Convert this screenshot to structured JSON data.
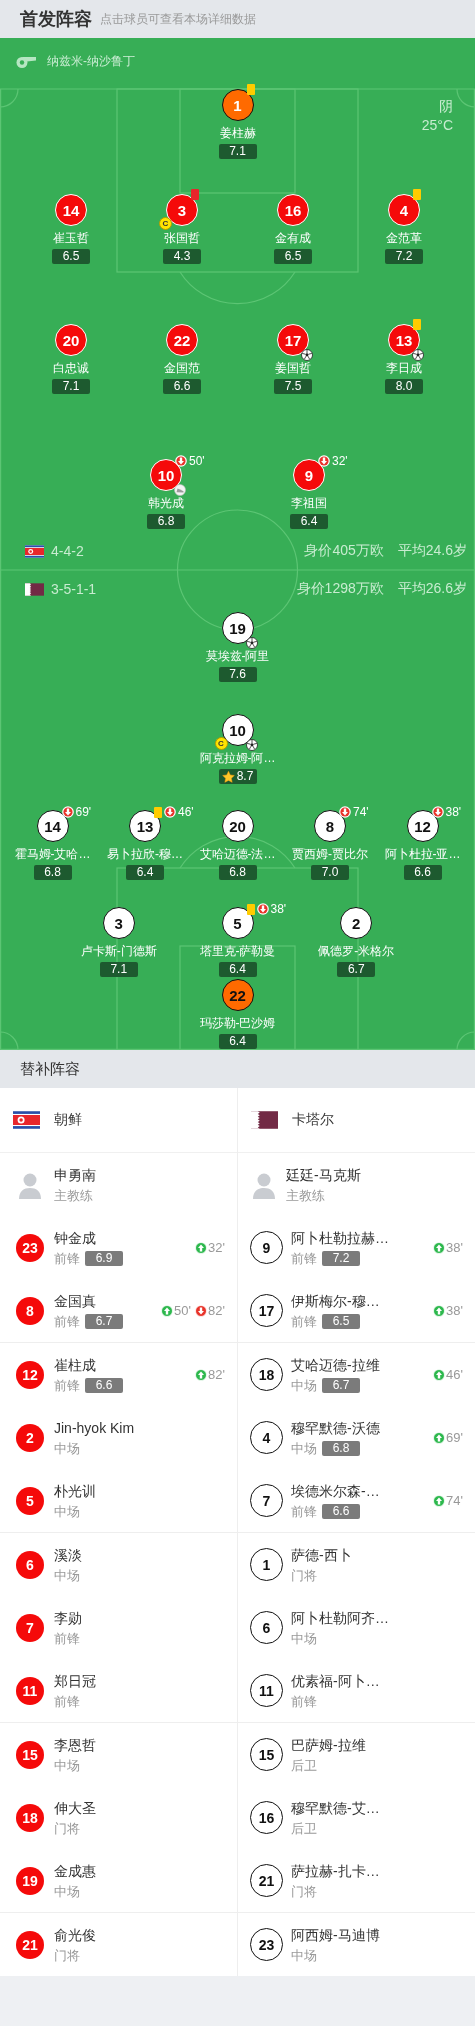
{
  "header": {
    "title": "首发阵容",
    "hint": "点击球员可查看本场详细数据"
  },
  "pitch": {
    "referee": "纳兹米-纳沙鲁丁",
    "weather": "阴",
    "temperature": "25°C",
    "teams": [
      {
        "kind": "home",
        "formation": "4-4-2",
        "value": "身价405万欧",
        "average_age": "平均24.6岁",
        "rows": [
          {
            "players": [
              {
                "number": "1",
                "name": "姜柱赫",
                "rating": "7.1",
                "keeper": true,
                "best": false,
                "yellow_card": true,
                "red_card": false,
                "goal": false,
                "assist": false
              }
            ]
          },
          {
            "players": [
              {
                "number": "14",
                "name": "崔玉哲",
                "rating": "6.5",
                "keeper": false,
                "best": false,
                "yellow_card": false,
                "red_card": false,
                "goal": false,
                "assist": false
              },
              {
                "number": "3",
                "name": "张国哲",
                "rating": "4.3",
                "keeper": false,
                "best": false,
                "yellow_card": false,
                "red_card": true,
                "goal": false,
                "assist": false,
                "captain_badge": "C"
              },
              {
                "number": "16",
                "name": "金有成",
                "rating": "6.5",
                "keeper": false,
                "best": false,
                "yellow_card": false,
                "red_card": false,
                "goal": false,
                "assist": false
              },
              {
                "number": "4",
                "name": "金范革",
                "rating": "7.2",
                "keeper": false,
                "best": false,
                "yellow_card": true,
                "red_card": false,
                "goal": false,
                "assist": false
              }
            ]
          },
          {
            "players": [
              {
                "number": "20",
                "name": "白忠诚",
                "rating": "7.1",
                "keeper": false,
                "best": false,
                "yellow_card": false,
                "red_card": false,
                "goal": false,
                "assist": false
              },
              {
                "number": "22",
                "name": "金国范",
                "rating": "6.6",
                "keeper": false,
                "best": false,
                "yellow_card": false,
                "red_card": false,
                "goal": false,
                "assist": false
              },
              {
                "number": "17",
                "name": "姜国哲",
                "rating": "7.5",
                "keeper": false,
                "best": false,
                "yellow_card": false,
                "red_card": false,
                "goal": true,
                "assist": false
              },
              {
                "number": "13",
                "name": "李日成",
                "rating": "8.0",
                "keeper": false,
                "best": false,
                "yellow_card": true,
                "red_card": false,
                "goal": true,
                "assist": false
              }
            ]
          },
          {
            "players": [
              {
                "number": "10",
                "name": "韩光成",
                "rating": "6.8",
                "keeper": false,
                "best": false,
                "yellow_card": false,
                "red_card": false,
                "goal": false,
                "assist": true,
                "sub_out": "50'"
              },
              {
                "number": "9",
                "name": "李祖国",
                "rating": "6.4",
                "keeper": false,
                "best": false,
                "yellow_card": false,
                "red_card": false,
                "goal": false,
                "assist": false,
                "sub_out": "32'"
              }
            ]
          }
        ]
      },
      {
        "kind": "away",
        "formation": "3-5-1-1",
        "value": "身价1298万欧",
        "average_age": "平均26.6岁",
        "rows": [
          {
            "players": [
              {
                "number": "19",
                "name": "莫埃兹-阿里",
                "rating": "7.6",
                "keeper": false,
                "best": false,
                "yellow_card": false,
                "red_card": false,
                "goal": true,
                "assist": false
              }
            ]
          },
          {
            "players": [
              {
                "number": "10",
                "name": "阿克拉姆-阿…",
                "rating": "8.7",
                "keeper": false,
                "best": true,
                "yellow_card": false,
                "red_card": false,
                "goal": true,
                "assist": false,
                "captain_badge": "C"
              }
            ]
          },
          {
            "players": [
              {
                "number": "14",
                "name": "霍马姆-艾哈…",
                "rating": "6.8",
                "keeper": false,
                "best": false,
                "yellow_card": false,
                "red_card": false,
                "goal": false,
                "assist": false,
                "sub_out": "69'"
              },
              {
                "number": "13",
                "name": "易卜拉欣-穆…",
                "rating": "6.4",
                "keeper": false,
                "best": false,
                "yellow_card": true,
                "red_card": false,
                "goal": false,
                "assist": false,
                "sub_out": "46'"
              },
              {
                "number": "20",
                "name": "艾哈迈德-法…",
                "rating": "6.8",
                "keeper": false,
                "best": false,
                "yellow_card": false,
                "red_card": false,
                "goal": false,
                "assist": false
              },
              {
                "number": "8",
                "name": "贾西姆-贾比尔",
                "rating": "7.0",
                "keeper": false,
                "best": false,
                "yellow_card": false,
                "red_card": false,
                "goal": false,
                "assist": false,
                "sub_out": "74'"
              },
              {
                "number": "12",
                "name": "阿卜杜拉-亚…",
                "rating": "6.6",
                "keeper": false,
                "best": false,
                "yellow_card": false,
                "red_card": false,
                "goal": false,
                "assist": false,
                "sub_out": "38'"
              }
            ]
          },
          {
            "players": [
              {
                "number": "3",
                "name": "卢卡斯-门德斯",
                "rating": "7.1",
                "keeper": false,
                "best": false,
                "yellow_card": false,
                "red_card": false,
                "goal": false,
                "assist": false
              },
              {
                "number": "5",
                "name": "塔里克-萨勒曼",
                "rating": "6.4",
                "keeper": false,
                "best": false,
                "yellow_card": true,
                "red_card": false,
                "goal": false,
                "assist": false,
                "sub_out": "38'"
              },
              {
                "number": "2",
                "name": "佩德罗-米格尔",
                "rating": "6.7",
                "keeper": false,
                "best": false,
                "yellow_card": false,
                "red_card": false,
                "goal": false,
                "assist": false
              }
            ]
          },
          {
            "players": [
              {
                "number": "22",
                "name": "玛莎勒-巴沙姆",
                "rating": "6.4",
                "keeper": true,
                "best": false,
                "yellow_card": false,
                "red_card": false,
                "goal": false,
                "assist": false
              }
            ]
          }
        ]
      }
    ]
  },
  "substitutes": {
    "title": "替补阵容",
    "teams": [
      {
        "kind": "home",
        "name": "朝鲜",
        "coach": {
          "name": "申勇南",
          "role": "主教练"
        },
        "players": [
          {
            "number": "23",
            "name": "钟金成",
            "position": "前锋",
            "rating": "6.9",
            "sub_in": "32'"
          },
          {
            "number": "8",
            "name": "金国真",
            "position": "前锋",
            "rating": "6.7",
            "sub_in": "50'",
            "sub_out": "82'"
          },
          {
            "number": "12",
            "name": "崔柱成",
            "position": "前锋",
            "rating": "6.6",
            "sub_in": "82'"
          },
          {
            "number": "2",
            "name": "Jin-hyok Kim",
            "position": "中场"
          },
          {
            "number": "5",
            "name": "朴光训",
            "position": "中场"
          },
          {
            "number": "6",
            "name": "溪淡",
            "position": "中场"
          },
          {
            "number": "7",
            "name": "李勋",
            "position": "前锋"
          },
          {
            "number": "11",
            "name": "郑日冠",
            "position": "前锋"
          },
          {
            "number": "15",
            "name": "李恩哲",
            "position": "中场"
          },
          {
            "number": "18",
            "name": "伸大圣",
            "position": "门将"
          },
          {
            "number": "19",
            "name": "金成惠",
            "position": "中场"
          },
          {
            "number": "21",
            "name": "俞光俊",
            "position": "门将"
          }
        ]
      },
      {
        "kind": "away",
        "name": "卡塔尔",
        "coach": {
          "name": "廷廷-马克斯",
          "role": "主教练"
        },
        "players": [
          {
            "number": "9",
            "name": "阿卜杜勒拉赫…",
            "position": "前锋",
            "rating": "7.2",
            "sub_in": "38'"
          },
          {
            "number": "17",
            "name": "伊斯梅尔-穆…",
            "position": "前锋",
            "rating": "6.5",
            "sub_in": "38'"
          },
          {
            "number": "18",
            "name": "艾哈迈德-拉维",
            "position": "中场",
            "rating": "6.7",
            "sub_in": "46'"
          },
          {
            "number": "4",
            "name": "穆罕默德-沃德",
            "position": "中场",
            "rating": "6.8",
            "sub_in": "69'"
          },
          {
            "number": "7",
            "name": "埃德米尔森-…",
            "position": "前锋",
            "rating": "6.6",
            "sub_in": "74'"
          },
          {
            "number": "1",
            "name": "萨德-西卜",
            "position": "门将"
          },
          {
            "number": "6",
            "name": "阿卜杜勒阿齐…",
            "position": "中场"
          },
          {
            "number": "11",
            "name": "优素福-阿卜…",
            "position": "前锋"
          },
          {
            "number": "15",
            "name": "巴萨姆-拉维",
            "position": "后卫"
          },
          {
            "number": "16",
            "name": "穆罕默德-艾…",
            "position": "后卫"
          },
          {
            "number": "21",
            "name": "萨拉赫-扎卡…",
            "position": "门将"
          },
          {
            "number": "23",
            "name": "阿西姆-马迪博",
            "position": "中场"
          }
        ]
      }
    ]
  }
}
